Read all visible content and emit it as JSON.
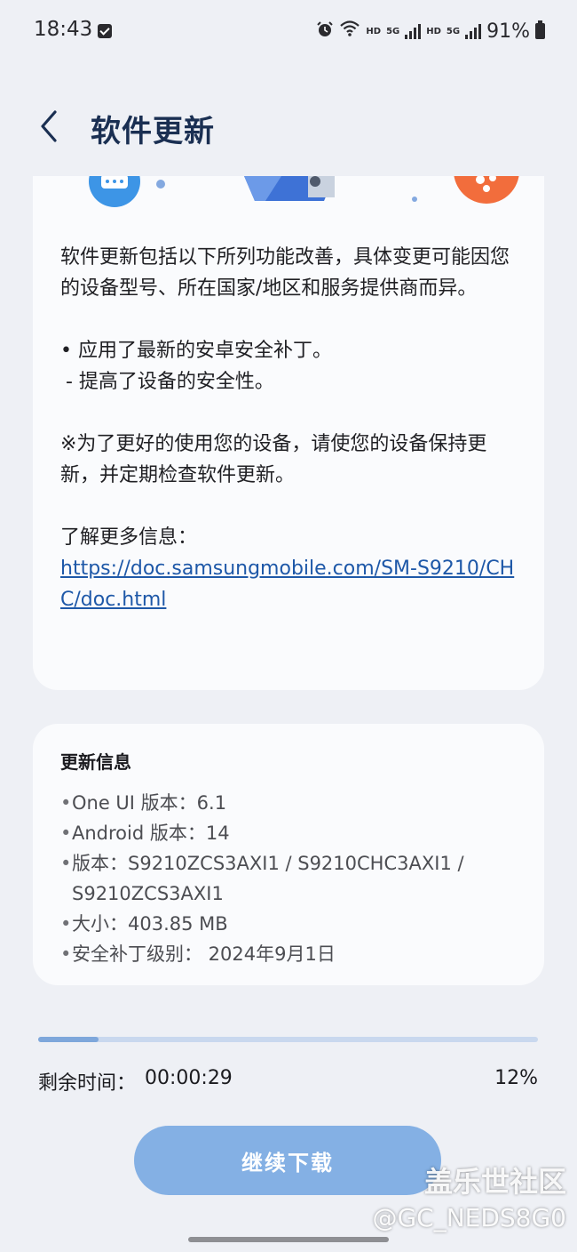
{
  "status_bar": {
    "time": "18:43",
    "net_label_1": "HD",
    "net_label_2": "5G",
    "net_label_3": "HD",
    "net_label_4": "5G",
    "battery": "91%",
    "icons": [
      "checkbox-icon",
      "alarm-icon",
      "wifi-icon",
      "signal-icon",
      "battery-icon"
    ]
  },
  "header": {
    "title": "软件更新",
    "back_icon": "chevron-left-icon"
  },
  "notes": {
    "intro": "软件更新包括以下所列功能改善，具体变更可能因您的设备型号、所在国家/地区和服务提供商而异。",
    "bullet": "• 应用了最新的安卓安全补丁。",
    "sub_bullet": "- 提高了设备的安全性。",
    "tip": "※为了更好的使用您的设备，请使您的设备保持更新，并定期检查软件更新。",
    "more_info_label": "了解更多信息：",
    "link": "https://doc.samsungmobile.com/SM-S9210/CHC/doc.html"
  },
  "update_info": {
    "title": "更新信息",
    "items": [
      "One UI 版本：6.1",
      "Android 版本：14",
      "版本：S9210ZCS3AXI1 / S9210CHC3AXI1 / S9210ZCS3AXI1",
      "大小：403.85 MB",
      "安全补丁级别： 2024年9月1日"
    ]
  },
  "download": {
    "progress_fraction": 0.12,
    "remaining_label": "剩余时间：",
    "remaining_time": "00:00:29",
    "percent": "12%",
    "button_label": "继续下载"
  },
  "watermark": {
    "name": "盖乐世社区",
    "handle": "@GC_NEDS8G0"
  },
  "colors": {
    "background": "#eef0f5",
    "card": "#fafbfd",
    "title": "#1a2f52",
    "link": "#1e58a8",
    "button": "#84b0e4",
    "progress_fill": "#7ea7db",
    "progress_track": "#c9d8ee"
  }
}
